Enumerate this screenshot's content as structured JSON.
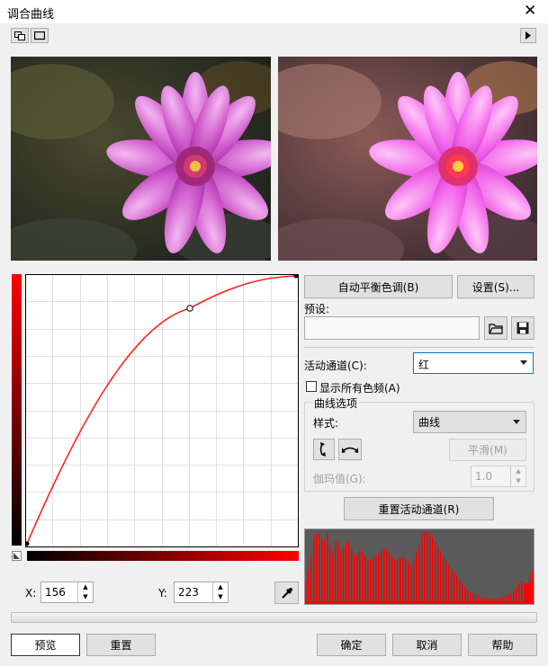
{
  "window": {
    "title": "调合曲线",
    "close_glyph": "✕"
  },
  "buttons": {
    "auto_balance": "自动平衡色调(B)",
    "settings": "设置(S)...",
    "smooth": "平滑(M)",
    "reset_channel": "重置活动通道(R)",
    "preview": "预览",
    "reset": "重置",
    "ok": "确定",
    "cancel": "取消",
    "help": "帮助"
  },
  "preset": {
    "label": "预设:",
    "value": ""
  },
  "channel": {
    "label": "活动通道(C):",
    "value": "红"
  },
  "show_all": {
    "label": "显示所有色频(A)",
    "checked": false
  },
  "curve_options": {
    "legend": "曲线选项",
    "style_label": "样式:",
    "style_value": "曲线",
    "gamma_label": "伽玛值(G):",
    "gamma_value": "1.0"
  },
  "coords": {
    "x_label": "X:",
    "x_value": "156",
    "y_label": "Y:",
    "y_value": "223"
  },
  "colors": {
    "curve": "#ff2020",
    "accent": "#0078d7"
  }
}
